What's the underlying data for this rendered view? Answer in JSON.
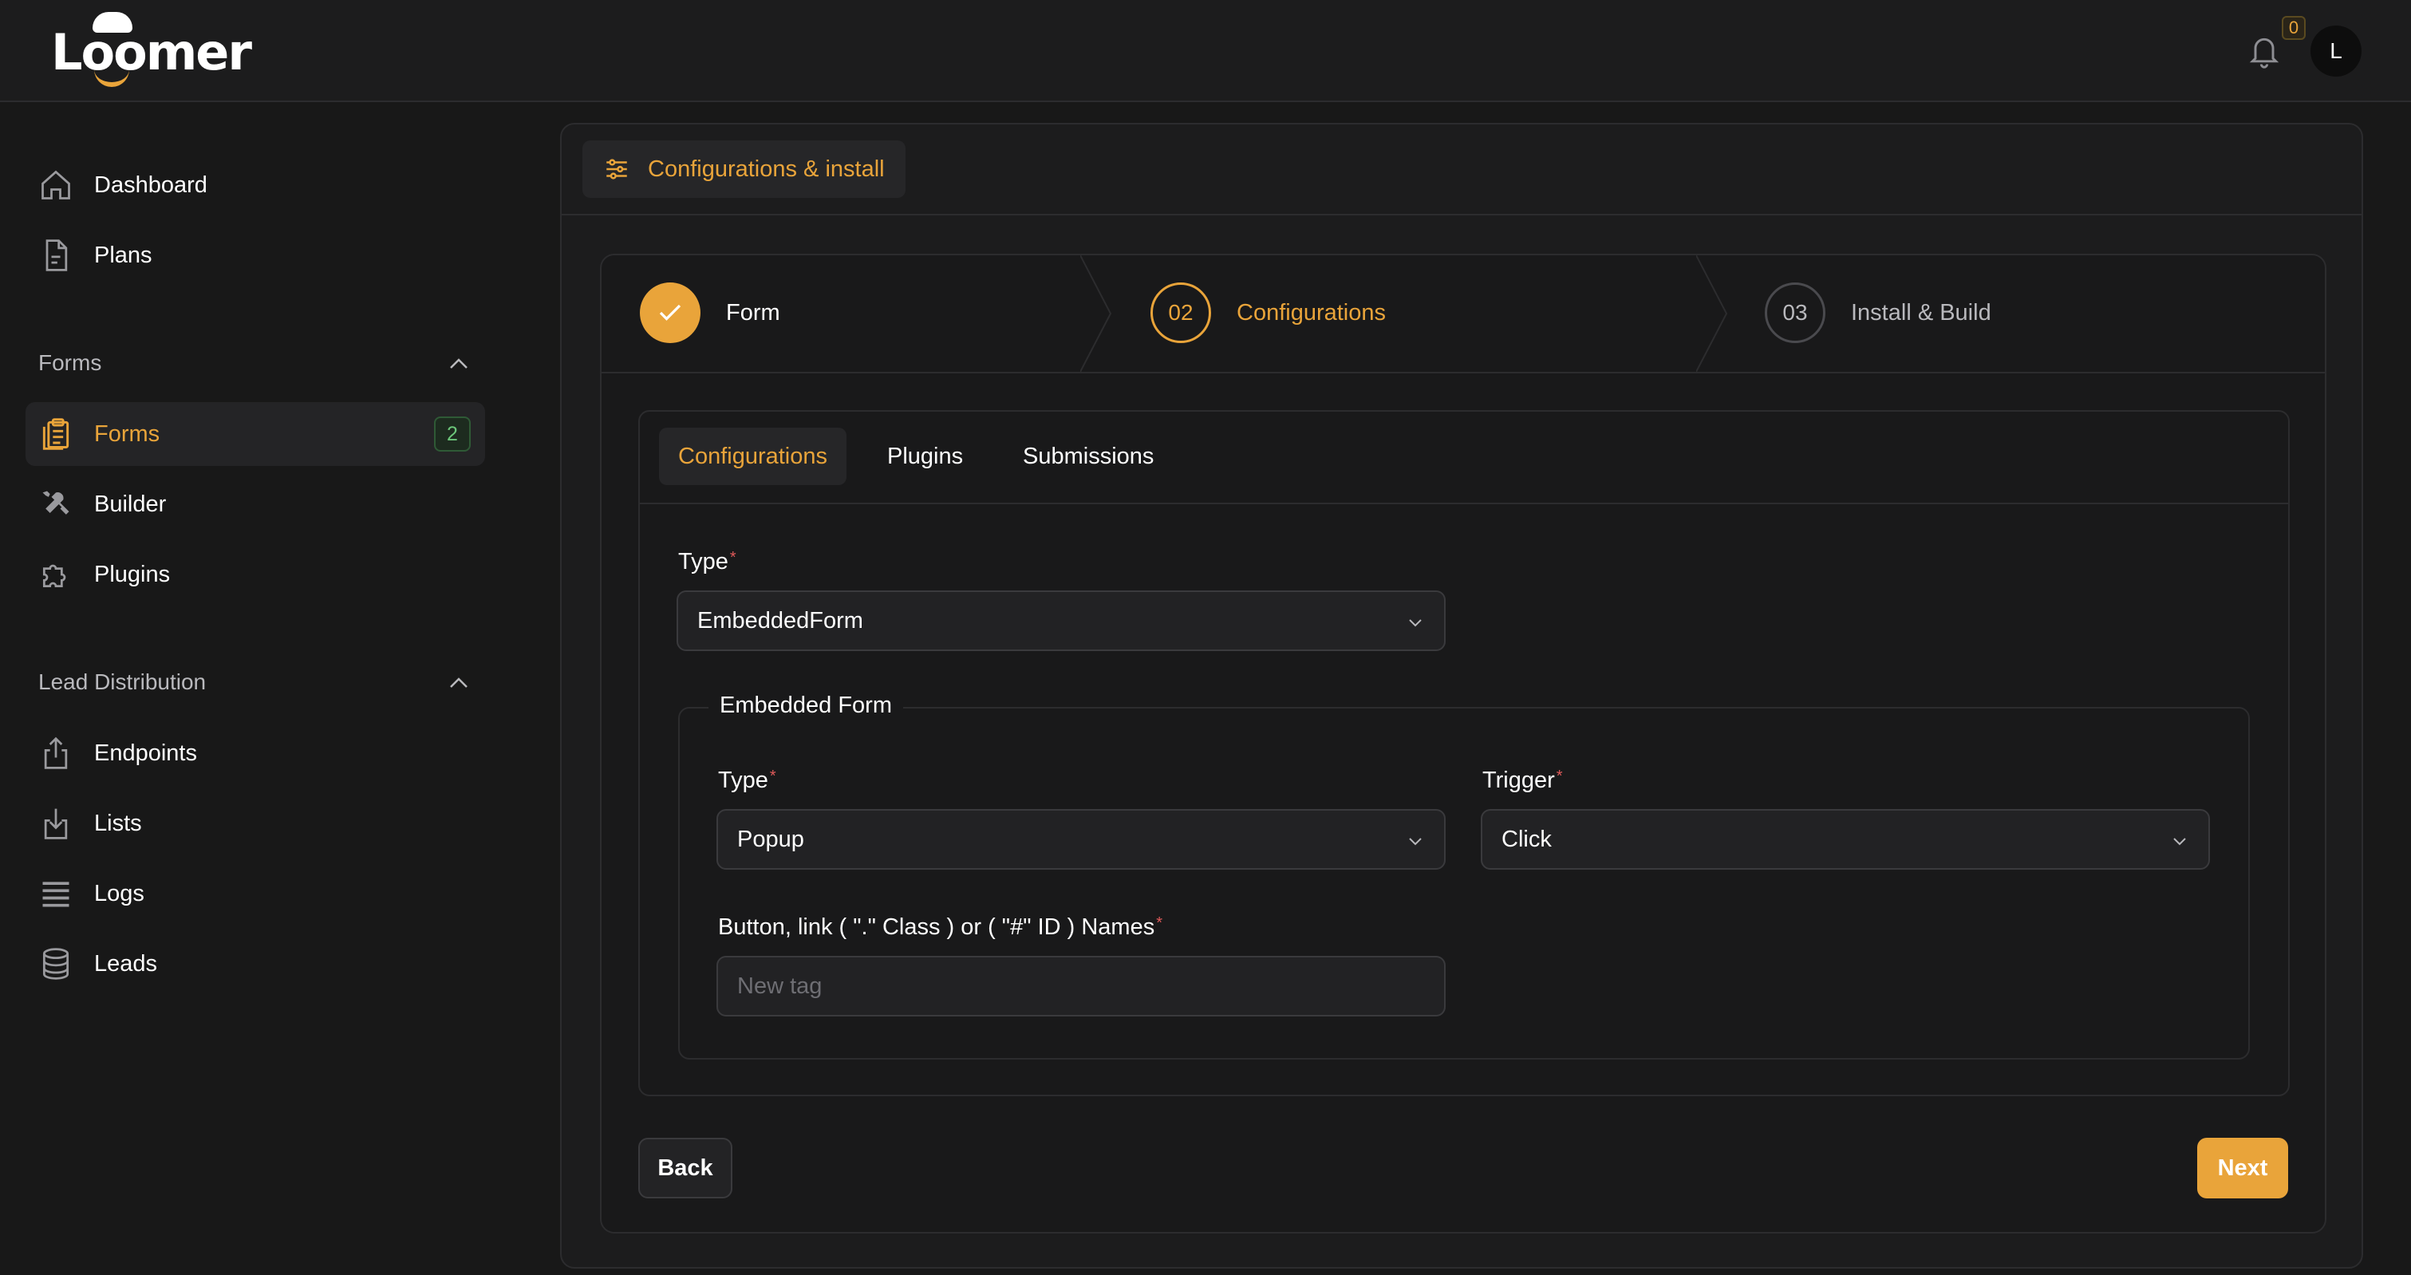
{
  "app": {
    "logo": "Loomer"
  },
  "header": {
    "notification_count": "0",
    "avatar_initial": "L"
  },
  "sidebar": {
    "top_items": [
      {
        "label": "Dashboard",
        "icon": "home-icon"
      },
      {
        "label": "Plans",
        "icon": "document-icon"
      }
    ],
    "forms_section": {
      "title": "Forms",
      "items": [
        {
          "label": "Forms",
          "icon": "clipboard-icon",
          "count": "2",
          "active": true
        },
        {
          "label": "Builder",
          "icon": "tools-icon"
        },
        {
          "label": "Plugins",
          "icon": "puzzle-icon"
        }
      ]
    },
    "lead_section": {
      "title": "Lead Distribution",
      "items": [
        {
          "label": "Endpoints",
          "icon": "upload-icon"
        },
        {
          "label": "Lists",
          "icon": "download-icon"
        },
        {
          "label": "Logs",
          "icon": "list-lines-icon"
        },
        {
          "label": "Leads",
          "icon": "database-icon"
        }
      ]
    }
  },
  "page": {
    "tab_label": "Configurations & install",
    "steps": [
      {
        "number": "",
        "label": "Form",
        "state": "complete"
      },
      {
        "number": "02",
        "label": "Configurations",
        "state": "current"
      },
      {
        "number": "03",
        "label": "Install & Build",
        "state": "upcoming"
      }
    ],
    "subtabs": [
      "Configurations",
      "Plugins",
      "Submissions"
    ],
    "type_field": {
      "label": "Type",
      "value": "EmbeddedForm"
    },
    "embedded_form": {
      "legend": "Embedded Form",
      "type_label": "Type",
      "type_value": "Popup",
      "trigger_label": "Trigger",
      "trigger_value": "Click",
      "names_label": "Button, link ( \".\" Class ) or ( \"#\" ID ) Names",
      "names_placeholder": "New tag"
    },
    "back_label": "Back",
    "next_label": "Next"
  },
  "colors": {
    "accent": "#e9a43a",
    "background": "#181818",
    "success": "#6cc77a",
    "required": "#e05a5a"
  }
}
